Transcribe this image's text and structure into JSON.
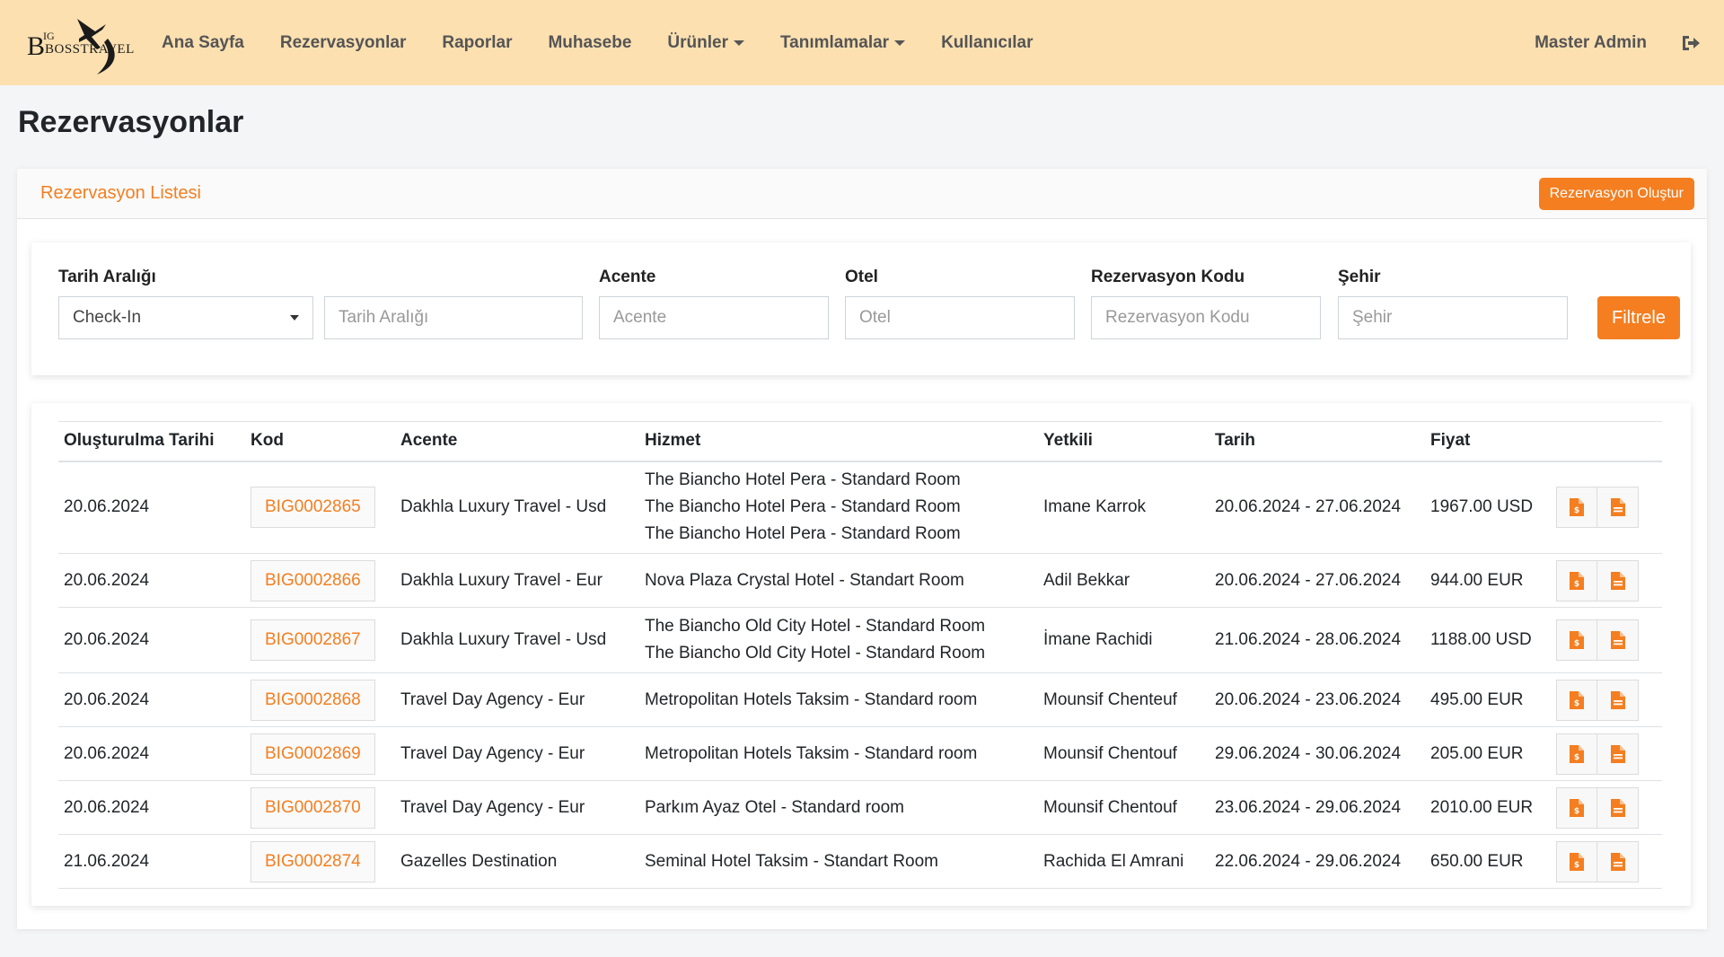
{
  "nav": {
    "logo": {
      "big": "B",
      "ig": "IG",
      "boss": "BOSSTRAVEL"
    },
    "items": [
      {
        "label": "Ana Sayfa",
        "dropdown": false
      },
      {
        "label": "Rezervasyonlar",
        "dropdown": false
      },
      {
        "label": "Raporlar",
        "dropdown": false
      },
      {
        "label": "Muhasebe",
        "dropdown": false
      },
      {
        "label": "Ürünler",
        "dropdown": true
      },
      {
        "label": "Tanımlamalar",
        "dropdown": true
      },
      {
        "label": "Kullanıcılar",
        "dropdown": false
      }
    ],
    "user": "Master Admin",
    "logout_icon": "logout-icon"
  },
  "page": {
    "title": "Rezervasyonlar"
  },
  "card": {
    "title": "Rezervasyon Listesi",
    "create_button": "Rezervasyon Oluştur"
  },
  "filters": {
    "date_range_label": "Tarih Aralığı",
    "date_type_value": "Check-In",
    "date_range_placeholder": "Tarih Aralığı",
    "agency_label": "Acente",
    "agency_placeholder": "Acente",
    "hotel_label": "Otel",
    "hotel_placeholder": "Otel",
    "code_label": "Rezervasyon Kodu",
    "code_placeholder": "Rezervasyon Kodu",
    "city_label": "Şehir",
    "city_placeholder": "Şehir",
    "filter_button": "Filtrele"
  },
  "table": {
    "headers": [
      "Oluşturulma Tarihi",
      "Kod",
      "Acente",
      "Hizmet",
      "Yetkili",
      "Tarih",
      "Fiyat"
    ],
    "rows": [
      {
        "created": "20.06.2024",
        "code": "BIG0002865",
        "agency": "Dakhla Luxury Travel - Usd",
        "services": [
          "The Biancho Hotel Pera - Standard Room",
          "The Biancho Hotel Pera - Standard Room",
          "The Biancho Hotel Pera - Standard Room"
        ],
        "contact": "Imane Karrok",
        "dates": "20.06.2024 - 27.06.2024",
        "price": "1967.00 USD"
      },
      {
        "created": "20.06.2024",
        "code": "BIG0002866",
        "agency": "Dakhla Luxury Travel - Eur",
        "services": [
          "Nova Plaza Crystal Hotel - Standart Room"
        ],
        "contact": "Adil Bekkar",
        "dates": "20.06.2024 - 27.06.2024",
        "price": "944.00 EUR"
      },
      {
        "created": "20.06.2024",
        "code": "BIG0002867",
        "agency": "Dakhla Luxury Travel - Usd",
        "services": [
          "The Biancho Old City Hotel - Standard Room",
          "The Biancho Old City Hotel - Standard Room"
        ],
        "contact": "İmane Rachidi",
        "dates": "21.06.2024 - 28.06.2024",
        "price": "1188.00 USD"
      },
      {
        "created": "20.06.2024",
        "code": "BIG0002868",
        "agency": "Travel Day Agency - Eur",
        "services": [
          "Metropolitan Hotels Taksim - Standard room"
        ],
        "contact": "Mounsif Chenteuf",
        "dates": "20.06.2024 - 23.06.2024",
        "price": "495.00 EUR"
      },
      {
        "created": "20.06.2024",
        "code": "BIG0002869",
        "agency": "Travel Day Agency - Eur",
        "services": [
          "Metropolitan Hotels Taksim - Standard room"
        ],
        "contact": "Mounsif Chentouf",
        "dates": "29.06.2024 - 30.06.2024",
        "price": "205.00 EUR"
      },
      {
        "created": "20.06.2024",
        "code": "BIG0002870",
        "agency": "Travel Day Agency - Eur",
        "services": [
          "Parkım Ayaz Otel - Standard room"
        ],
        "contact": "Mounsif Chentouf",
        "dates": "23.06.2024 - 29.06.2024",
        "price": "2010.00 EUR"
      },
      {
        "created": "21.06.2024",
        "code": "BIG0002874",
        "agency": "Gazelles Destination",
        "services": [
          "Seminal Hotel Taksim - Standart Room"
        ],
        "contact": "Rachida El Amrani",
        "dates": "22.06.2024 - 29.06.2024",
        "price": "650.00 EUR"
      }
    ],
    "action_icons": [
      "invoice-icon",
      "document-icon"
    ]
  },
  "colors": {
    "accent": "#f47e20",
    "navbar": "#fce0b0",
    "nav_text": "#555555"
  }
}
